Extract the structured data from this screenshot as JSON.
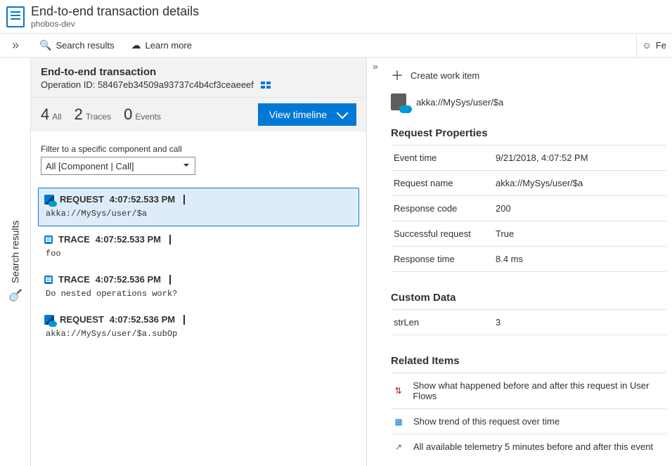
{
  "header": {
    "title": "End-to-end transaction details",
    "subtitle": "phobos-dev"
  },
  "toolbar": {
    "search": "Search results",
    "learn_more": "Learn more",
    "feedback": "Fe"
  },
  "left_rail_label": "Search results",
  "operation": {
    "title": "End-to-end transaction",
    "op_id_label": "Operation ID:",
    "op_id": "58467eb34509a93737c4b4cf3ceaeeef"
  },
  "counts": [
    {
      "num": "4",
      "label": "All"
    },
    {
      "num": "2",
      "label": "Traces"
    },
    {
      "num": "0",
      "label": "Events"
    }
  ],
  "view_timeline_label": "View timeline",
  "filter": {
    "label": "Filter to a specific component and call",
    "value": "All [Component | Call]"
  },
  "traces": [
    {
      "type": "REQUEST",
      "time": "4:07:52.533 PM",
      "body": "akka://MySys/user/$a",
      "icon": "req",
      "selected": true
    },
    {
      "type": "TRACE",
      "time": "4:07:52.533 PM",
      "body": "foo",
      "icon": "trace",
      "selected": false
    },
    {
      "type": "TRACE",
      "time": "4:07:52.536 PM",
      "body": "Do nested operations work?",
      "icon": "trace",
      "selected": false
    },
    {
      "type": "REQUEST",
      "time": "4:07:52.536 PM",
      "body": "akka://MySys/user/$a.subOp",
      "icon": "req",
      "selected": false
    }
  ],
  "right": {
    "create_work_item": "Create work item",
    "entity": "akka://MySys/user/$a",
    "request_properties_title": "Request Properties",
    "props": [
      {
        "k": "Event time",
        "v": "9/21/2018, 4:07:52 PM"
      },
      {
        "k": "Request name",
        "v": "akka://MySys/user/$a"
      },
      {
        "k": "Response code",
        "v": "200"
      },
      {
        "k": "Successful request",
        "v": "True"
      },
      {
        "k": "Response time",
        "v": "8.4 ms"
      }
    ],
    "custom_data_title": "Custom Data",
    "custom": [
      {
        "k": "strLen",
        "v": "3"
      }
    ],
    "related_title": "Related Items",
    "related": [
      "Show what happened before and after this request in User Flows",
      "Show trend of this request over time",
      "All available telemetry 5 minutes before and after this event"
    ]
  }
}
